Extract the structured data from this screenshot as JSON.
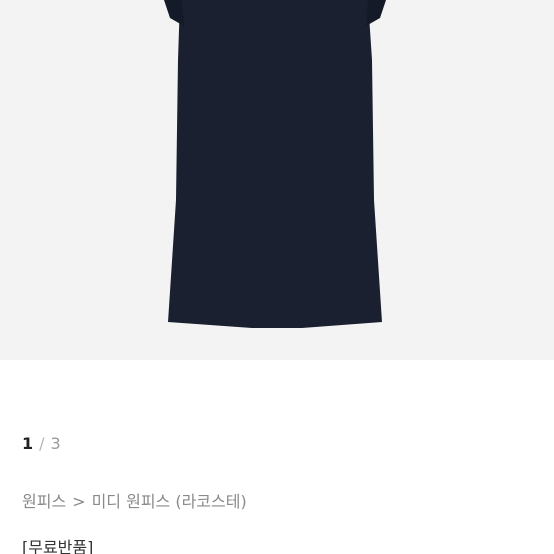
{
  "product_image": {
    "subject": "dress-image",
    "colors": {
      "background": "#f3f3f3",
      "garment": "#1b2030"
    }
  },
  "pager": {
    "current": "1",
    "separator": "/",
    "total": "3"
  },
  "breadcrumb": {
    "category": "원피스",
    "separator": ">",
    "subcategory": "미디 원피스 (라코스테)"
  },
  "tag_text": "[무료반품]"
}
